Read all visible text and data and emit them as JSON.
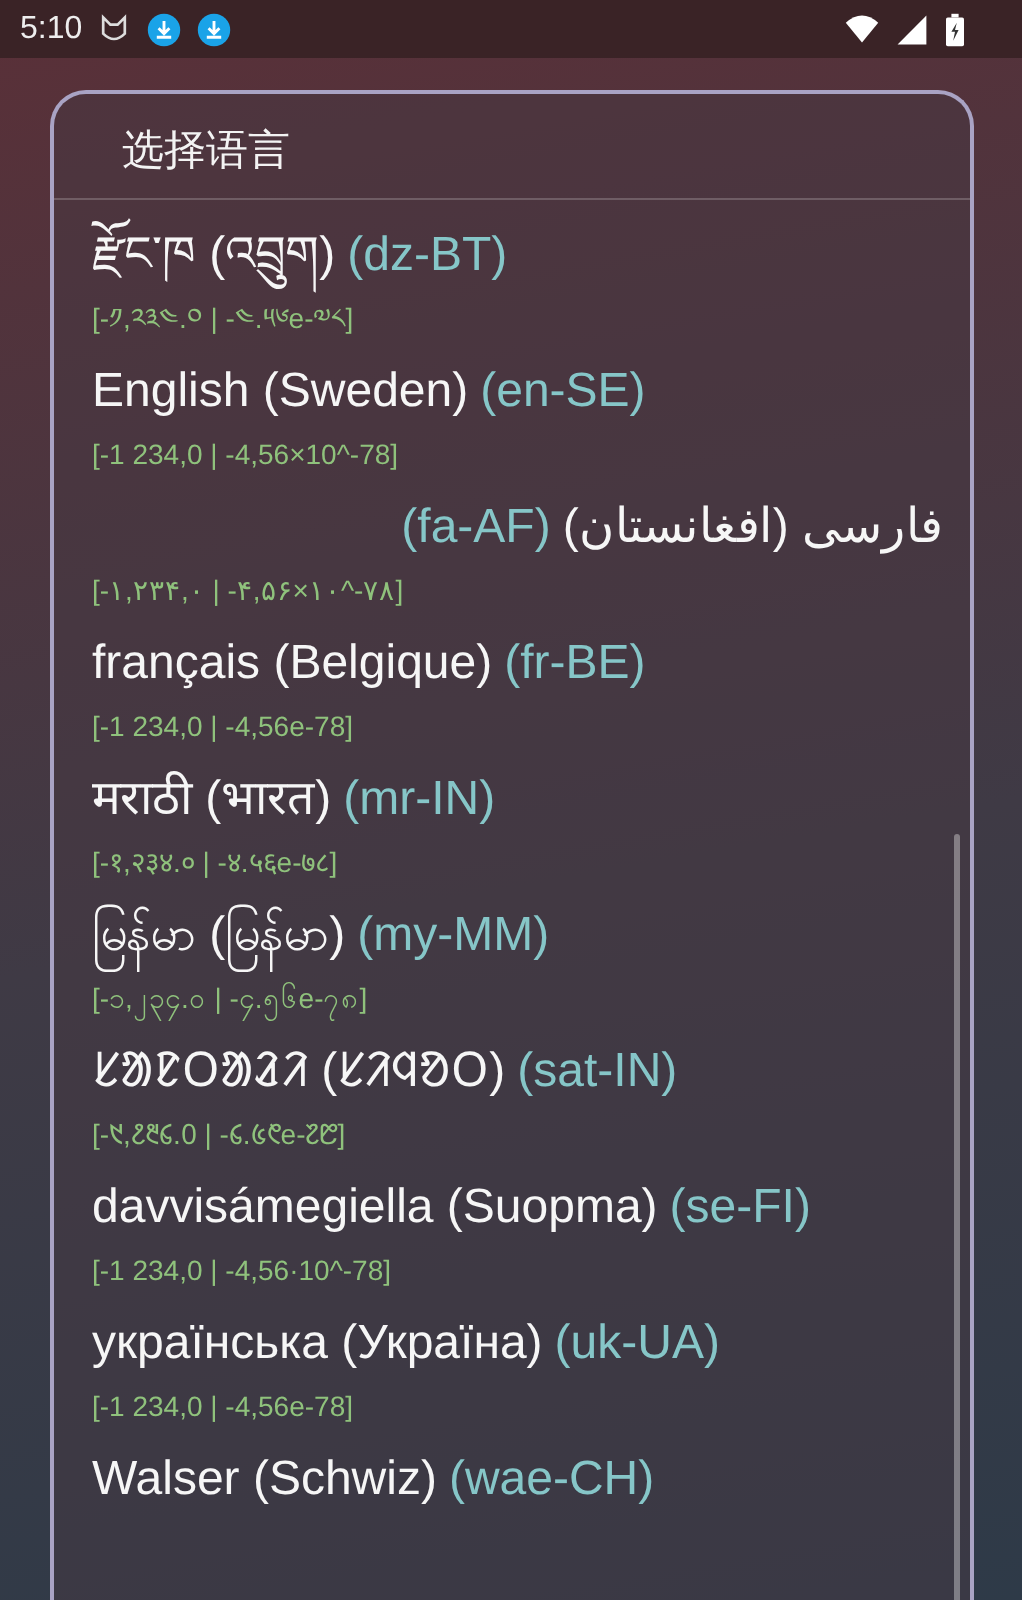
{
  "status_bar": {
    "time": "5:10"
  },
  "dialog": {
    "title": "选择语言",
    "languages": [
      {
        "name": "རྫོང་ཁ (འབྲུག)",
        "code": "(dz-BT)",
        "sample": "[-༡,༢༣༤.༠ | -༤.༥༦e-༧༨]",
        "rtl": false
      },
      {
        "name": "English (Sweden)",
        "code": "(en-SE)",
        "sample": "[-1 234,0 | -4,56×10^-78]",
        "rtl": false
      },
      {
        "name": "فارسی (افغانستان)",
        "code": "(fa-AF)",
        "sample": "[-۱,۲۳۴,۰ | -۴,۵۶×۱۰^-۷۸]",
        "rtl": true
      },
      {
        "name": "français (Belgique)",
        "code": "(fr-BE)",
        "sample": "[-1 234,0 | -4,56e-78]",
        "rtl": false
      },
      {
        "name": "मराठी (भारत)",
        "code": "(mr-IN)",
        "sample": "[-१,२३४.० | -४.५६e-७८]",
        "rtl": false
      },
      {
        "name": "မြန်မာ (မြန်မာ)",
        "code": "(my-MM)",
        "sample": "[-၁,၂၃၄.၀ | -၄.၅၆e-၇၈]",
        "rtl": false
      },
      {
        "name": "ᱥᱟᱱᱛᱟᱲᱤ (ᱥᱤᱧᱚᱛ)",
        "code": "(sat-IN)",
        "sample": "[-᱑,᱒᱓᱔.᱐ | -᱔.᱕᱖e-᱗᱘]",
        "rtl": false
      },
      {
        "name": "davvisámegiella (Suopma)",
        "code": "(se-FI)",
        "sample": "[-1 234,0 | -4,56·10^-78]",
        "rtl": false
      },
      {
        "name": "українська (Україна)",
        "code": "(uk-UA)",
        "sample": "[-1 234,0 | -4,56e-78]",
        "rtl": false
      },
      {
        "name": "Walser (Schwiz)",
        "code": "(wae-CH)",
        "rtl": false
      }
    ]
  }
}
